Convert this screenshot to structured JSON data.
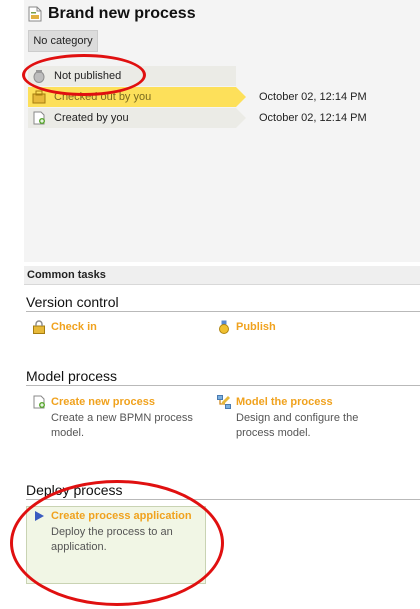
{
  "header": {
    "title": "Brand new process"
  },
  "category": "No category",
  "status": {
    "published": "Not published",
    "checked_out": {
      "label": "Checked out by you",
      "date": "October 02, 12:14 PM"
    },
    "created": {
      "label": "Created by you",
      "date": "October 02, 12:14 PM"
    }
  },
  "common_tasks": {
    "title": "Common tasks"
  },
  "sections": {
    "version_control": {
      "title": "Version control",
      "check_in": "Check in",
      "publish": "Publish"
    },
    "model_process": {
      "title": "Model process",
      "create_new": {
        "title": "Create new process",
        "desc": "Create a new BPMN process model."
      },
      "model_the": {
        "title": "Model the process",
        "desc": "Design and configure the process model."
      }
    },
    "deploy_process": {
      "title": "Deploy process",
      "create_app": {
        "title": "Create process application",
        "desc": "Deploy the process to an application."
      }
    }
  },
  "colors": {
    "task_link": "#f0a21e",
    "checked_out_bg": "#fde05a",
    "annotation": "#e01010"
  },
  "icons": [
    "process-document-icon",
    "unpublished-icon",
    "checked-out-icon",
    "created-icon",
    "lock-icon",
    "publish-medal-icon",
    "new-process-icon",
    "model-process-icon",
    "play-arrow-icon"
  ]
}
